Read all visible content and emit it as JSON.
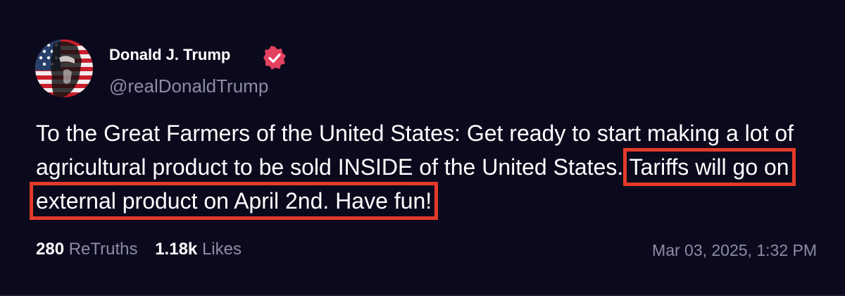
{
  "author": {
    "name": "Donald J. Trump",
    "handle": "@realDonaldTrump",
    "verified": true,
    "avatar_icon": "profile-photo-flag-portrait",
    "badge_icon": "verified-badge-icon",
    "badge_color": "#e4405f"
  },
  "post": {
    "text_before": "To the Great Farmers of the United States: Get ready to start making a lot of agricultural product to be sold INSIDE of the United States. ",
    "text_highlighted": "Tariffs will go on external product on April 2nd. Have fun!",
    "highlight_color": "#e33b2a"
  },
  "stats": {
    "retruths_count": "280",
    "retruths_label": "ReTruths",
    "likes_count": "1.18k",
    "likes_label": "Likes"
  },
  "timestamp": "Mar 03, 2025, 1:32 PM",
  "colors": {
    "background": "#0b0a1d",
    "text": "#ffffff",
    "muted": "#8e8ca6"
  }
}
